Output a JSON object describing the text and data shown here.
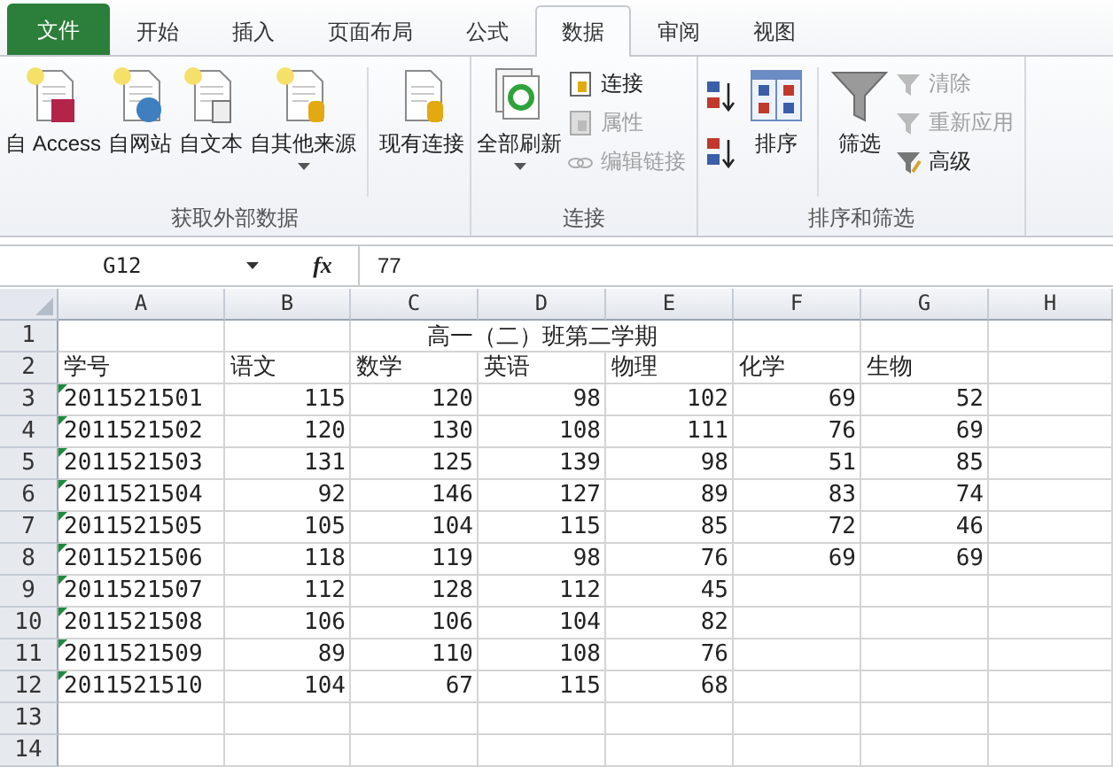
{
  "ribbon": {
    "tabs": [
      {
        "label": "文件",
        "kind": "file",
        "selected": false
      },
      {
        "label": "开始",
        "kind": "tab",
        "selected": false
      },
      {
        "label": "插入",
        "kind": "tab",
        "selected": false
      },
      {
        "label": "页面布局",
        "kind": "tab",
        "selected": false
      },
      {
        "label": "公式",
        "kind": "tab",
        "selected": false
      },
      {
        "label": "数据",
        "kind": "tab",
        "selected": true
      },
      {
        "label": "审阅",
        "kind": "tab",
        "selected": false
      },
      {
        "label": "视图",
        "kind": "tab",
        "selected": false
      }
    ],
    "groups": [
      {
        "label": "获取外部数据",
        "items": [
          {
            "kind": "large",
            "label": "自 Access",
            "dropdown": false
          },
          {
            "kind": "large",
            "label": "自网站",
            "dropdown": false
          },
          {
            "kind": "large",
            "label": "自文本",
            "dropdown": false
          },
          {
            "kind": "large",
            "label": "自其他来源",
            "dropdown": true
          },
          {
            "kind": "separator"
          },
          {
            "kind": "large",
            "label": "现有连接",
            "dropdown": false
          }
        ]
      },
      {
        "label": "连接",
        "items": [
          {
            "kind": "large",
            "label": "全部刷新",
            "dropdown": true
          },
          {
            "kind": "stack",
            "items": [
              {
                "label": "连接",
                "disabled": false
              },
              {
                "label": "属性",
                "disabled": true
              },
              {
                "label": "编辑链接",
                "disabled": true
              }
            ]
          }
        ]
      },
      {
        "label": "排序和筛选",
        "items": [
          {
            "kind": "iconstack"
          },
          {
            "kind": "large",
            "label": "排序",
            "dropdown": false
          },
          {
            "kind": "separator"
          },
          {
            "kind": "large",
            "label": "筛选",
            "dropdown": false
          },
          {
            "kind": "stack",
            "items": [
              {
                "label": "清除",
                "disabled": true
              },
              {
                "label": "重新应用",
                "disabled": true
              },
              {
                "label": "高级",
                "disabled": false
              }
            ]
          }
        ]
      }
    ]
  },
  "formula_bar": {
    "name_box": "G12",
    "fx": "fx",
    "value": "77"
  },
  "sheet": {
    "columns": [
      "A",
      "B",
      "C",
      "D",
      "E",
      "F",
      "G",
      "H"
    ],
    "rows": [
      {
        "number": "1",
        "kind": "title",
        "title": "高一（二）班第二学期"
      },
      {
        "number": "2",
        "kind": "header",
        "cells": [
          "学号",
          "语文",
          "数学",
          "英语",
          "物理",
          "化学",
          "生物"
        ]
      },
      {
        "number": "3",
        "kind": "data",
        "text_flag": true,
        "cells": [
          "2011521501",
          "115",
          "120",
          "98",
          "102",
          "69",
          "52"
        ]
      },
      {
        "number": "4",
        "kind": "data",
        "text_flag": true,
        "cells": [
          "2011521502",
          "120",
          "130",
          "108",
          "111",
          "76",
          "69"
        ]
      },
      {
        "number": "5",
        "kind": "data",
        "text_flag": true,
        "cells": [
          "2011521503",
          "131",
          "125",
          "139",
          "98",
          "51",
          "85"
        ]
      },
      {
        "number": "6",
        "kind": "data",
        "text_flag": true,
        "cells": [
          "2011521504",
          "92",
          "146",
          "127",
          "89",
          "83",
          "74"
        ]
      },
      {
        "number": "7",
        "kind": "data",
        "text_flag": true,
        "cells": [
          "2011521505",
          "105",
          "104",
          "115",
          "85",
          "72",
          "46"
        ]
      },
      {
        "number": "8",
        "kind": "data",
        "text_flag": true,
        "cells": [
          "2011521506",
          "118",
          "119",
          "98",
          "76",
          "69",
          "69"
        ]
      },
      {
        "number": "9",
        "kind": "data",
        "text_flag": true,
        "cells": [
          "2011521507",
          "112",
          "128",
          "112",
          "45"
        ]
      },
      {
        "number": "10",
        "kind": "data",
        "text_flag": true,
        "cells": [
          "2011521508",
          "106",
          "106",
          "104",
          "82"
        ]
      },
      {
        "number": "11",
        "kind": "data",
        "text_flag": true,
        "cells": [
          "2011521509",
          "89",
          "110",
          "108",
          "76"
        ]
      },
      {
        "number": "12",
        "kind": "data",
        "text_flag": true,
        "cells": [
          "2011521510",
          "104",
          "67",
          "115",
          "68"
        ]
      },
      {
        "number": "13",
        "kind": "empty"
      },
      {
        "number": "14",
        "kind": "empty"
      }
    ]
  }
}
